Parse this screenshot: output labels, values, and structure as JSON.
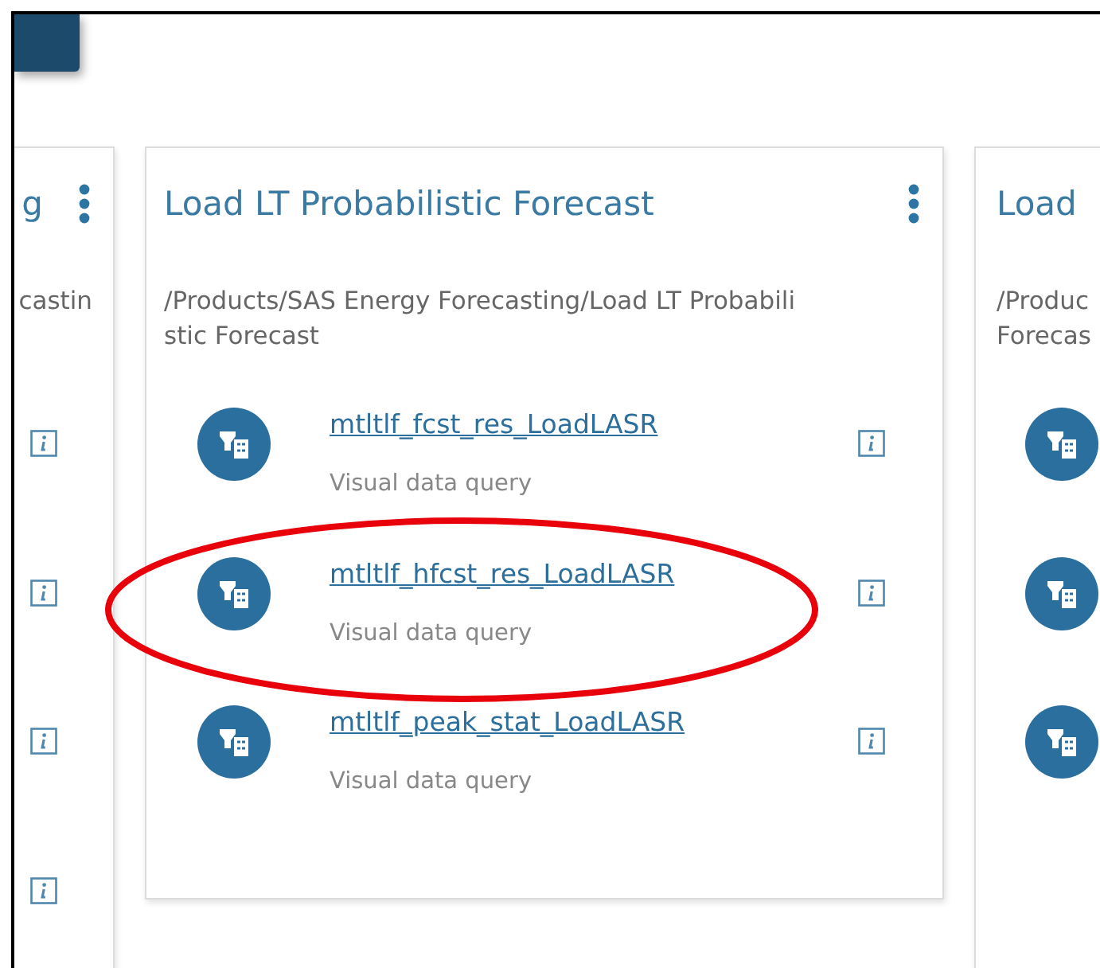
{
  "cards": [
    {
      "kind": "clipped-left",
      "title": "g",
      "path_lines": [
        "castin"
      ],
      "items": [
        {
          "kind": "info-only"
        },
        {
          "kind": "info-only"
        },
        {
          "kind": "info-only"
        },
        {
          "kind": "info-only"
        }
      ]
    },
    {
      "kind": "full",
      "title": "Load LT Probabilistic Forecast",
      "path_lines": [
        "/Products/SAS Energy Forecasting/Load LT Probabili",
        "stic Forecast"
      ],
      "items": [
        {
          "kind": "full",
          "name": "mtltlf_fcst_res_LoadLASR",
          "type": "Visual data query"
        },
        {
          "kind": "full",
          "name": "mtltlf_hfcst_res_LoadLASR",
          "type": "Visual data query"
        },
        {
          "kind": "full",
          "name": "mtltlf_peak_stat_LoadLASR",
          "type": "Visual data query"
        }
      ]
    },
    {
      "kind": "clipped-right",
      "title": "Load",
      "path_lines": [
        "/Produc",
        "Forecas"
      ],
      "items": [
        {
          "kind": "icon-only"
        },
        {
          "kind": "icon-only"
        },
        {
          "kind": "icon-only"
        }
      ]
    }
  ]
}
